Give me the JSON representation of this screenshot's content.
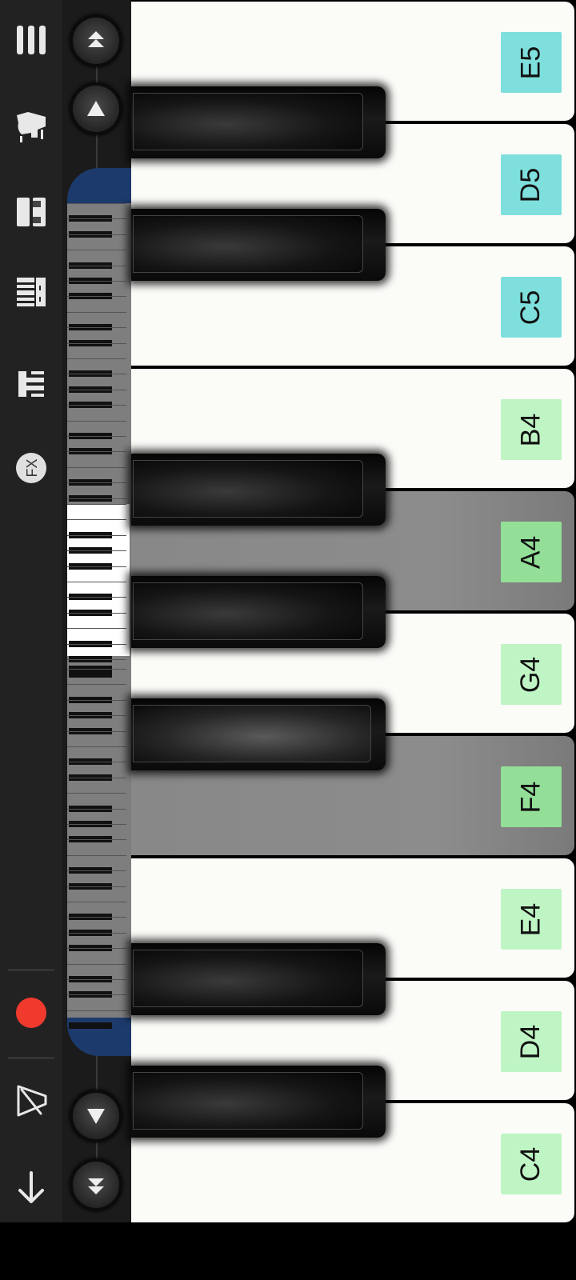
{
  "toolbar": {
    "items": [
      {
        "id": "menu",
        "icon": "menu-icon"
      },
      {
        "id": "instrument",
        "icon": "grand-piano-icon"
      },
      {
        "id": "layout",
        "icon": "dual-keyboard-icon"
      },
      {
        "id": "keys",
        "icon": "piano-keys-icon"
      },
      {
        "id": "chords",
        "icon": "chord-icon"
      },
      {
        "id": "fx",
        "icon": "fx-icon",
        "label": "FX"
      },
      {
        "id": "record",
        "icon": "record-icon",
        "color": "#f03a2e"
      },
      {
        "id": "metronome",
        "icon": "metronome-icon"
      },
      {
        "id": "download",
        "icon": "download-arrow-icon"
      }
    ]
  },
  "navigation": {
    "octave_up": "double-chevron-up-icon",
    "key_up": "chevron-up-icon",
    "key_down": "chevron-down-icon",
    "octave_down": "double-chevron-down-icon"
  },
  "keyboard": {
    "white_keys": [
      {
        "note": "E5",
        "octave": 5,
        "pressed": false
      },
      {
        "note": "D5",
        "octave": 5,
        "pressed": false
      },
      {
        "note": "C5",
        "octave": 5,
        "pressed": false
      },
      {
        "note": "B4",
        "octave": 4,
        "pressed": false
      },
      {
        "note": "A4",
        "octave": 4,
        "pressed": true
      },
      {
        "note": "G4",
        "octave": 4,
        "pressed": false
      },
      {
        "note": "F4",
        "octave": 4,
        "pressed": true
      },
      {
        "note": "E4",
        "octave": 4,
        "pressed": false
      },
      {
        "note": "D4",
        "octave": 4,
        "pressed": false
      },
      {
        "note": "C4",
        "octave": 4,
        "pressed": false
      }
    ],
    "black_keys": [
      {
        "note": "D#5",
        "pressed": false
      },
      {
        "note": "C#5",
        "pressed": false
      },
      {
        "note": "A#4",
        "pressed": false
      },
      {
        "note": "G#4",
        "pressed": false
      },
      {
        "note": "F#4",
        "pressed": true
      },
      {
        "note": "D#4",
        "pressed": false
      },
      {
        "note": "C#4",
        "pressed": false
      }
    ]
  },
  "colors": {
    "label_octave4": "#bff5c4",
    "label_octave5": "#7edfdc",
    "label_pressed": "#93df98",
    "record": "#f03a2e",
    "minimap_frame": "#1c3a6b"
  }
}
